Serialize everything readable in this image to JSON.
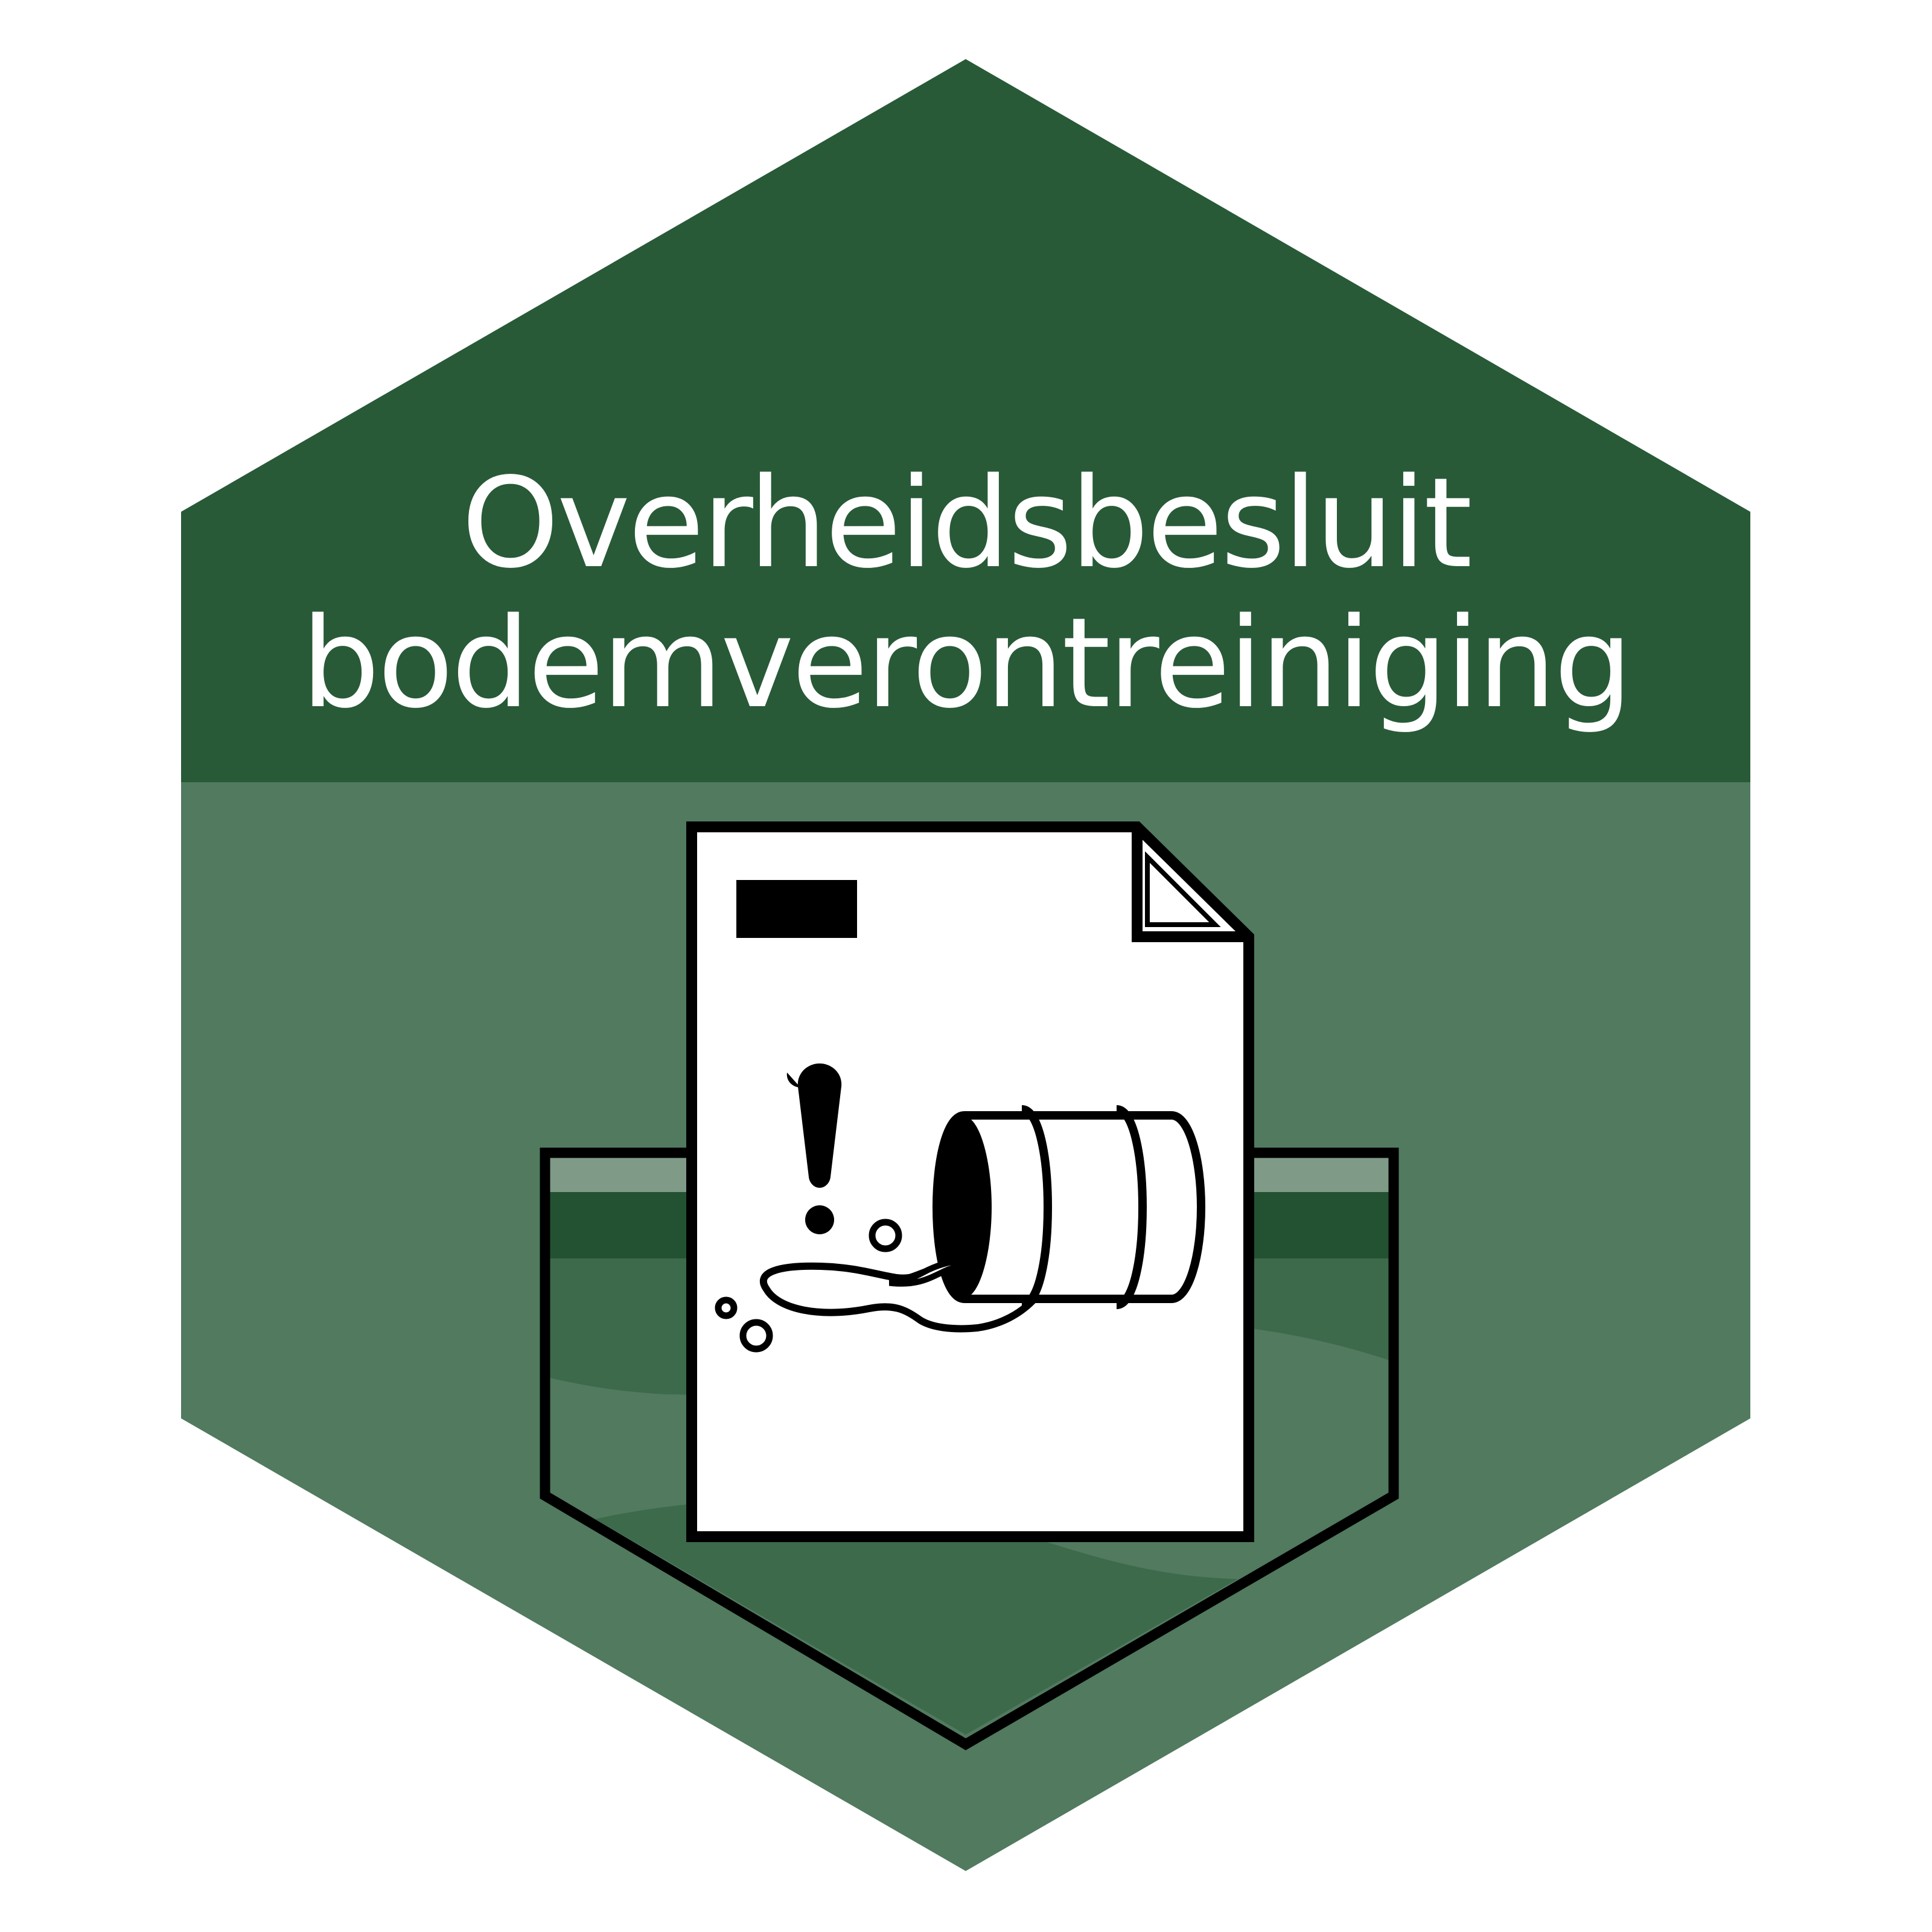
{
  "badge": {
    "title_line_1": "Overheidsbesluit",
    "title_line_2": "bodemverontreiniging",
    "icon": "document-with-spilled-barrel-icon"
  },
  "colors": {
    "header_green": "#285a37",
    "body_green": "#517a5f",
    "ground_dark": "#235232",
    "ground_mid": "#3d6a4a",
    "ground_light": "#7f9a87",
    "outline": "#000000",
    "paper": "#ffffff",
    "text": "#ffffff"
  }
}
